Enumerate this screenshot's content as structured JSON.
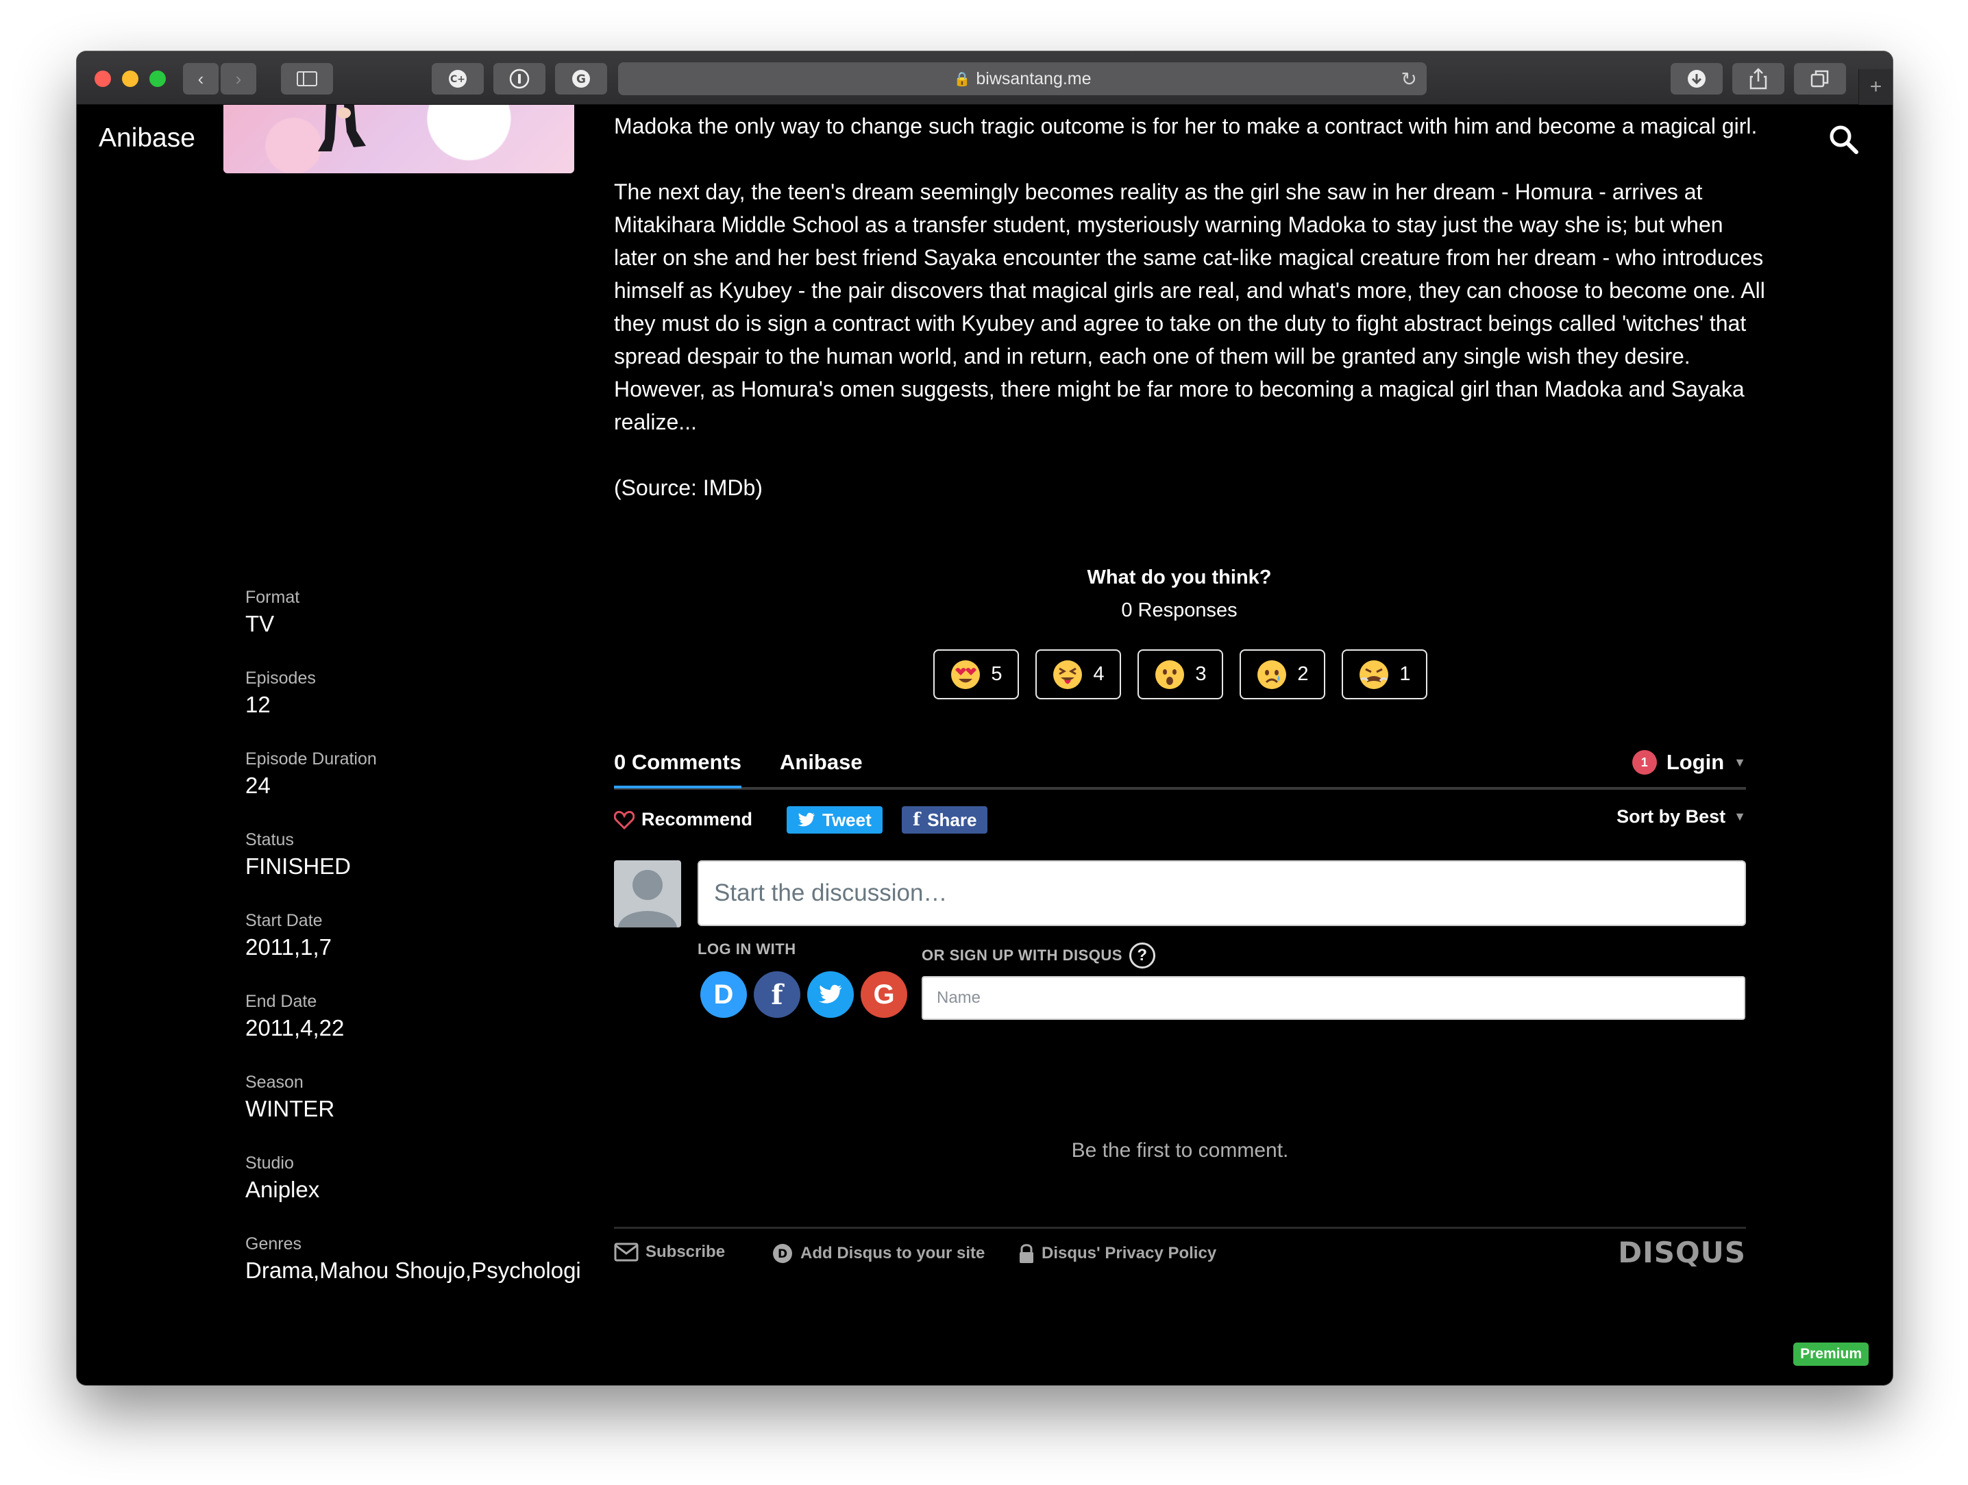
{
  "browser": {
    "url": "biwsantang.me",
    "tabs_plus": "+"
  },
  "site": {
    "brand": "Anibase"
  },
  "synopsis": {
    "paragraph1": "Madoka the only way to change such tragic outcome is for her to make a contract with him and become a magical girl.",
    "paragraph2": "The next day, the teen's dream seemingly becomes reality as the girl she saw in her dream - Homura - arrives at Mitakihara Middle School as a transfer student, mysteriously warning Madoka to stay just the way she is; but when later on she and her best friend Sayaka encounter the same cat-like magical creature from her dream - who introduces himself as Kyubey - the pair discovers that magical girls are real, and what's more, they can choose to become one. All they must do is sign a contract with Kyubey and agree to take on the duty to fight abstract beings called 'witches' that spread despair to the human world, and in return, each one of them will be granted any single wish they desire. However, as Homura's omen suggests, there might be far more to becoming a magical girl than Madoka and Sayaka realize...",
    "source": "(Source: IMDb)"
  },
  "details": [
    {
      "label": "Format",
      "value": "TV"
    },
    {
      "label": "Episodes",
      "value": "12"
    },
    {
      "label": "Episode Duration",
      "value": "24"
    },
    {
      "label": "Status",
      "value": "FINISHED"
    },
    {
      "label": "Start Date",
      "value": "2011,1,7"
    },
    {
      "label": "End Date",
      "value": "2011,4,22"
    },
    {
      "label": "Season",
      "value": "WINTER"
    },
    {
      "label": "Studio",
      "value": "Aniplex"
    },
    {
      "label": "Genres",
      "value": "Drama,Mahou Shoujo,Psychologi"
    }
  ],
  "reactions": {
    "title": "What do you think?",
    "responses": "0 Responses",
    "items": [
      {
        "icon": "heart-eyes-emoji-icon",
        "count": "5"
      },
      {
        "icon": "tongue-out-emoji-icon",
        "count": "4"
      },
      {
        "icon": "surprised-emoji-icon",
        "count": "3"
      },
      {
        "icon": "sad-emoji-icon",
        "count": "2"
      },
      {
        "icon": "angry-emoji-icon",
        "count": "1"
      }
    ]
  },
  "disqus": {
    "tab_comments": "0 Comments",
    "tab_site": "Anibase",
    "login_badge": "1",
    "login": "Login",
    "recommend": "Recommend",
    "tweet": "Tweet",
    "share": "Share",
    "sort": "Sort by Best",
    "compose_placeholder": "Start the discussion…",
    "log_in_with": "LOG IN WITH",
    "sign_up": "OR SIGN UP WITH DISQUS",
    "name_placeholder": "Name",
    "empty": "Be the first to comment.",
    "footer": {
      "subscribe": "Subscribe",
      "add": "Add Disqus to your site",
      "privacy": "Disqus' Privacy Policy",
      "logo": "DISQUS"
    },
    "colors": {
      "accent": "#2e9fff",
      "twitter": "#1da1f2",
      "facebook": "#3b5998",
      "google": "#dd4b39"
    }
  },
  "badge": "Premium"
}
